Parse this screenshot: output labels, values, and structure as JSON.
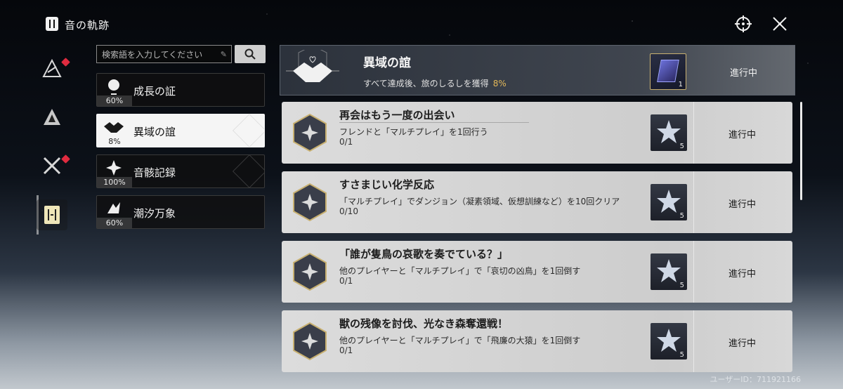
{
  "header": {
    "title": "音の軌跡"
  },
  "search": {
    "placeholder": "検索語を入力してください"
  },
  "categories": [
    {
      "label": "成長の証",
      "percent": "60%"
    },
    {
      "label": "異域の誼",
      "percent": "8%"
    },
    {
      "label": "音骸記録",
      "percent": "100%"
    },
    {
      "label": "潮汐万象",
      "percent": "60%"
    }
  ],
  "banner": {
    "title": "異域の誼",
    "description": "すべて達成後、旅のしるしを獲得",
    "percent": "8%",
    "reward_count": "1",
    "status": "進行中"
  },
  "achievements": [
    {
      "title": "再会はもう一度の出会い",
      "description": "フレンドと「マルチプレイ」を1回行う",
      "progress": "0/1",
      "reward_count": "5",
      "status": "進行中"
    },
    {
      "title": "すさまじい化学反応",
      "description": "「マルチプレイ」でダンジョン（凝素領域、仮想訓練など）を10回クリア",
      "progress": "0/10",
      "reward_count": "5",
      "status": "進行中"
    },
    {
      "title": "「誰が隻鳥の哀歌を奏でている？」",
      "description": "他のプレイヤーと「マルチプレイ」で「哀切の凶鳥」を1回倒す",
      "progress": "0/1",
      "reward_count": "5",
      "status": "進行中"
    },
    {
      "title": "獣の残像を討伐、光なき森奪還戦！",
      "description": "他のプレイヤーと「マルチプレイ」で「飛廉の大猿」を1回倒す",
      "progress": "0/1",
      "reward_count": "5",
      "status": "進行中"
    }
  ],
  "footer": {
    "user_id": "ユーザーID：711921166"
  }
}
